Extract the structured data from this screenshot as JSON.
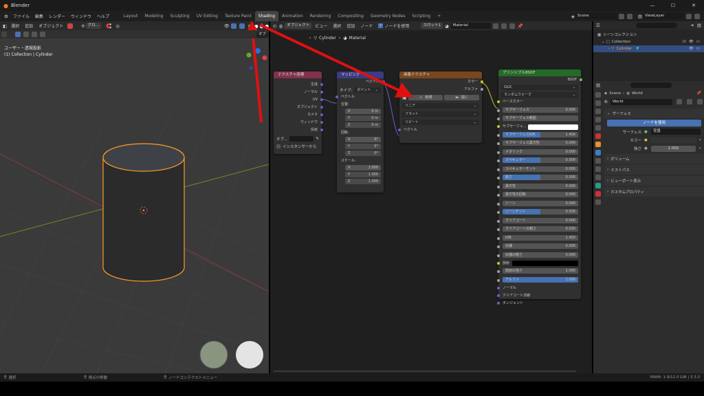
{
  "window": {
    "title": "Blender",
    "minimize": "—",
    "maximize": "☐",
    "close": "✕"
  },
  "menus": [
    "ファイル",
    "編集",
    "レンダー",
    "ウィンドウ",
    "ヘルプ"
  ],
  "workspaces": [
    "Layout",
    "Modeling",
    "Sculpting",
    "UV Editing",
    "Texture Paint",
    "Shading",
    "Animation",
    "Rendering",
    "Compositing",
    "Geometry Nodes",
    "Scripting",
    "+"
  ],
  "scene": {
    "label": "Scene",
    "viewlayer": "ViewLayer"
  },
  "viewport": {
    "toolbar": [
      "選択",
      "追加",
      "オブジェクト"
    ],
    "mode": "グロ…",
    "info_line1": "ユーザー・透視投影",
    "info_line2": "(1) Collection | Cylinder",
    "overlay_label": "オブ"
  },
  "node_header": {
    "object": "オブジェクト",
    "menus": [
      "ビュー",
      "選択",
      "追加",
      "ノード"
    ],
    "use_nodes": "ノードを使用",
    "slot": "スロット1",
    "material": "Material",
    "breadcrumb_obj": "Cylinder",
    "breadcrumb_mat": "Material"
  },
  "nodes": {
    "texcoord": {
      "title": "テクスチャ座標",
      "outputs": [
        "生成",
        "ノーマル",
        "UV",
        "オブジェクト",
        "カメラ",
        "ウィンドウ",
        "反射"
      ],
      "obj_label": "オブ...",
      "instancer": "インスタンサーから"
    },
    "mapping": {
      "title": "マッピング",
      "out": "ベクトル",
      "type_label": "タイプ:",
      "type_val": "ポイント",
      "vector": "ベクトル",
      "location": "位置:",
      "loc": [
        {
          "a": "X",
          "v": "0 m"
        },
        {
          "a": "Y",
          "v": "0 m"
        },
        {
          "a": "Z",
          "v": "0 m"
        }
      ],
      "rotation": "回転:",
      "rot": [
        {
          "a": "X",
          "v": "0°"
        },
        {
          "a": "Y",
          "v": "0°"
        },
        {
          "a": "Z",
          "v": "0°"
        }
      ],
      "scale": "スケール:",
      "scl": [
        {
          "a": "X",
          "v": "1.000"
        },
        {
          "a": "Y",
          "v": "1.000"
        },
        {
          "a": "Z",
          "v": "1.000"
        }
      ]
    },
    "image": {
      "title": "画像テクスチャ",
      "out_color": "カラー",
      "out_alpha": "アルファ",
      "new": "新規",
      "open": "開く",
      "interp": "リニア",
      "proj": "フラット",
      "ext": "リピート",
      "vector": "ベクトル"
    },
    "bsdf": {
      "title": "プリンシプルBSDF",
      "out": "BSDF",
      "dist": "GGX",
      "sss": "ランダムウォーク",
      "base_color": "ベースカラー",
      "props": [
        {
          "l": "サブサーフェス",
          "v": "0.000",
          "hl": 0
        },
        {
          "l": "サブサーフェス範囲",
          "v": "",
          "hl": 0
        },
        {
          "l": "サブサーフェ...",
          "v": "",
          "hl": 2
        },
        {
          "l": "サブサーフェスIOR",
          "v": "1.400",
          "hl": 1
        },
        {
          "l": "サブサーフェス異方性",
          "v": "0.000",
          "hl": 0
        },
        {
          "l": "メタリック",
          "v": "0.000",
          "hl": 0
        },
        {
          "l": "スペキュラー",
          "v": "0.500",
          "hl": 1
        },
        {
          "l": "スペキュラーチント",
          "v": "0.000",
          "hl": 0
        },
        {
          "l": "粗さ",
          "v": "0.500",
          "hl": 1
        },
        {
          "l": "異方性",
          "v": "0.000",
          "hl": 0
        },
        {
          "l": "異方性の回転",
          "v": "0.000",
          "hl": 0
        },
        {
          "l": "シーン",
          "v": "0.000",
          "hl": 0
        },
        {
          "l": "シーンチント",
          "v": "0.500",
          "hl": 1
        },
        {
          "l": "クリアコート",
          "v": "0.000",
          "hl": 0
        },
        {
          "l": "クリアコートの粗さ",
          "v": "0.030",
          "hl": 0
        },
        {
          "l": "IOR",
          "v": "1.450",
          "hl": 0
        },
        {
          "l": "伝播",
          "v": "0.000",
          "hl": 0
        },
        {
          "l": "伝播の粗さ",
          "v": "0.000",
          "hl": 0
        }
      ],
      "emission": "放射",
      "emission_strength": "放射の強さ",
      "emission_strength_v": "1.000",
      "alpha": "アルファ",
      "alpha_v": "1.000",
      "normal": "ノーマル",
      "cc_normal": "クリアコート法線",
      "tangent": "タンジェント"
    }
  },
  "outliner": {
    "scene_collection": "シーンコレクション",
    "collection": "Collection",
    "cylinder": "Cylinder"
  },
  "properties": {
    "scene": "Scene",
    "world": "World",
    "world_name": "World",
    "surface": "サーフェス",
    "use_nodes": "ノードを使用",
    "surface_label": "サーフェス",
    "surface_val": "背景",
    "color": "カラー",
    "strength": "強さ",
    "strength_val": "1.000",
    "sections": [
      "ボリューム",
      "ミストパス",
      "ビューポート表示",
      "カスタムプロパティ"
    ]
  },
  "status": {
    "select": "選択",
    "rotate": "視点の移動",
    "context": "ノードコンテクストメニュー",
    "vram": "VRAM: 1.9/12.0 GiB | 3.3.0"
  },
  "colors": {
    "accent": "#4772b3",
    "arrow": "#e01010",
    "selection": "#ffa033",
    "texcoord_head": "#83314a",
    "mapping_head": "#3c3c83",
    "image_head": "#79461d",
    "bsdf_head": "#246a28"
  }
}
